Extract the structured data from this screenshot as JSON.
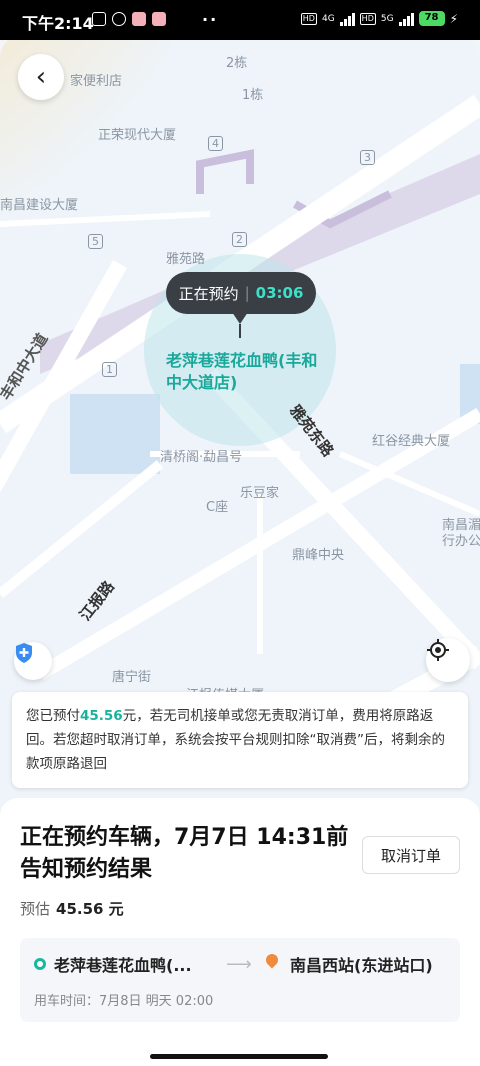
{
  "status_bar": {
    "time": "下午2:14",
    "dots": "··",
    "net1": "4G",
    "hd1": "HD",
    "hd2": "HD",
    "net2": "5G",
    "battery": "78"
  },
  "map": {
    "labels": [
      {
        "key": "l1",
        "text": "家便利店"
      },
      {
        "key": "l2",
        "text": "2栋"
      },
      {
        "key": "l3",
        "text": "1栋"
      },
      {
        "key": "l4",
        "text": "正荣现代大厦"
      },
      {
        "key": "l5",
        "text": "4"
      },
      {
        "key": "l6",
        "text": "3"
      },
      {
        "key": "l7",
        "text": "南昌建设大厦"
      },
      {
        "key": "l8",
        "text": "5"
      },
      {
        "key": "l9",
        "text": "2"
      },
      {
        "key": "l10",
        "text": "雅苑路"
      },
      {
        "key": "l11",
        "text": "1"
      },
      {
        "key": "l12",
        "text": "清桥阁·勐昌号"
      },
      {
        "key": "l13",
        "text": "乐豆家"
      },
      {
        "key": "l14",
        "text": "C座"
      },
      {
        "key": "l15",
        "text": "红谷经典大厦"
      },
      {
        "key": "l16",
        "text": "南昌湄"
      },
      {
        "key": "l17",
        "text": "行办公"
      },
      {
        "key": "l18",
        "text": "鼎峰中央"
      },
      {
        "key": "l19",
        "text": "唐宁街"
      },
      {
        "key": "l20",
        "text": "江报传媒大厦"
      }
    ],
    "roads": {
      "fenghe": "丰和中大道",
      "yayuan_east": "雅苑东路",
      "jiangbao": "江报路"
    },
    "bubble_status": "正在预约",
    "bubble_timer": "03:06",
    "destination_name": "老萍巷莲花血鸭(丰和中大道店)"
  },
  "notice": {
    "part1": "您已预付",
    "amount": "45.56",
    "part2": "元，若无司机接单或您无责取消订单，费用将原路返回。若您超时取消订单，系统会按平台规则扣除“取消费”后，将剩余的款项原路退回"
  },
  "panel": {
    "headline": "正在预约车辆，7月7日 14:31前告知预约结果",
    "cancel_label": "取消订单",
    "estimate_label": "预估",
    "estimate_price": "45.56 元",
    "origin": "老萍巷莲花血鸭(...",
    "destination": "南昌西站(东进站口)",
    "ride_time": "用车时间：7月8日 明天 02:00"
  },
  "colors": {
    "accent": "#18b39d",
    "dest_pin": "#f08a3c",
    "bubble_bg": "#3a3e45"
  }
}
